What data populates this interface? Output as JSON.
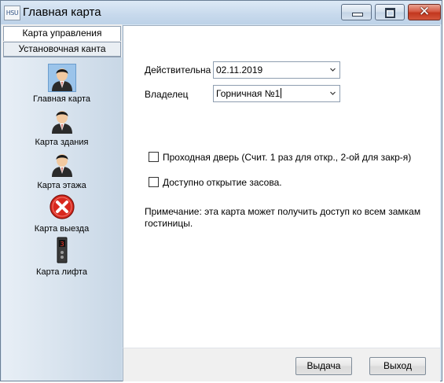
{
  "window": {
    "icon_text": "HSU",
    "title": "Главная карта",
    "close_glyph": "✕"
  },
  "tabs": [
    {
      "label": "Карта управления",
      "active": true
    },
    {
      "label": "Установочная канта",
      "active": false
    }
  ],
  "card_types": [
    {
      "label": "Главная карта",
      "icon": "person-icon",
      "selected": true
    },
    {
      "label": "Карта здания",
      "icon": "person-icon",
      "selected": false
    },
    {
      "label": "Карта этажа",
      "icon": "person-icon",
      "selected": false
    },
    {
      "label": "Карта выезда",
      "icon": "exit-x-icon",
      "selected": false
    },
    {
      "label": "Карта лифта",
      "icon": "elevator-icon",
      "selected": false
    }
  ],
  "elevator_digit": "3",
  "form": {
    "valid_label": "Действительна",
    "valid_value": "02.11.2019",
    "owner_label": "Владелец",
    "owner_value": "Горничная №1",
    "passage_door_label": "Проходная дверь (Счит. 1 раз для откр., 2-ой для закр-я)",
    "passage_door_checked": false,
    "deadbolt_label": "Доступно открытие засова.",
    "deadbolt_checked": false,
    "note": "Примечание: эта карта может получить доступ ко всем замкам гостиницы."
  },
  "buttons": {
    "issue": "Выдача",
    "exit": "Выход"
  },
  "colors": {
    "selected_icon_bg": "#9bc4ea",
    "close_button": "#c2361d",
    "exit_icon_red": "#d8281e"
  }
}
